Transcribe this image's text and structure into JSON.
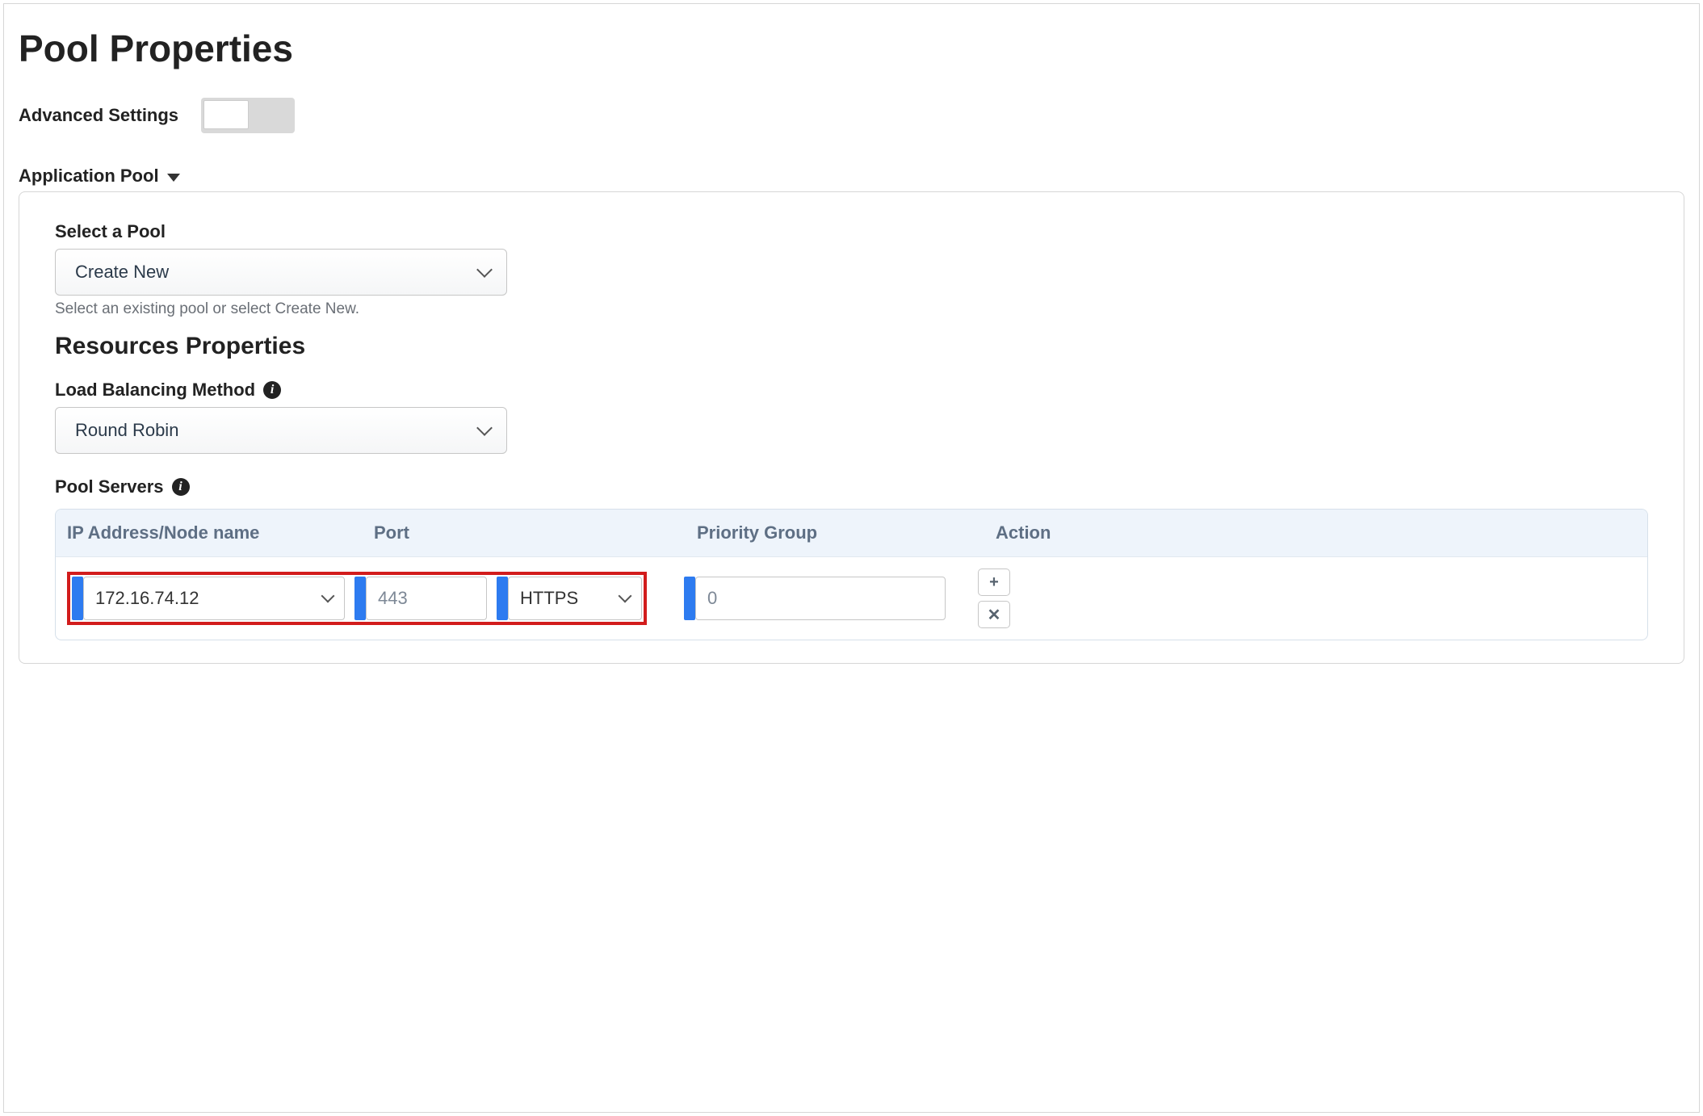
{
  "title": "Pool Properties",
  "advanced_settings_label": "Advanced Settings",
  "section": {
    "header": "Application Pool"
  },
  "select_pool": {
    "label": "Select a Pool",
    "value": "Create New",
    "helper": "Select an existing pool or select Create New."
  },
  "resources_title": "Resources Properties",
  "lb_method": {
    "label": "Load Balancing Method",
    "value": "Round Robin"
  },
  "pool_servers": {
    "label": "Pool Servers",
    "columns": {
      "ip": "IP Address/Node name",
      "port": "Port",
      "priority": "Priority Group",
      "action": "Action"
    },
    "row": {
      "ip": "172.16.74.12",
      "port": "443",
      "protocol": "HTTPS",
      "priority": "0"
    },
    "actions": {
      "add": "+",
      "remove": "✕"
    }
  }
}
